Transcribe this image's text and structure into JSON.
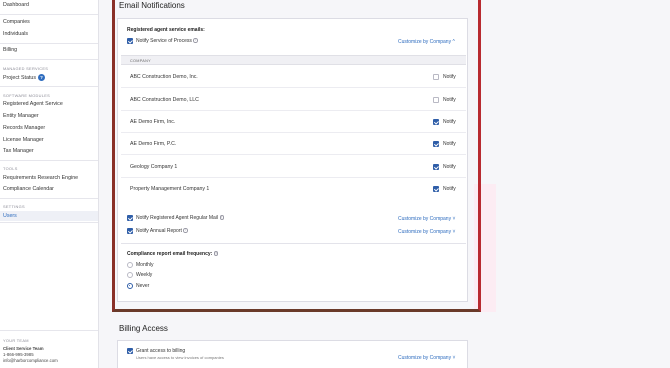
{
  "sidebar": {
    "top_items": [
      "Dashboard",
      "Companies",
      "Individuals",
      "Billing"
    ],
    "managed_services": {
      "heading": "MANAGED SERVICES",
      "items": [
        "Project Status"
      ],
      "badge": "?"
    },
    "software_modules": {
      "heading": "SOFTWARE MODULES",
      "items": [
        "Registered Agent Service",
        "Entity Manager",
        "Records Manager",
        "License Manager",
        "Tax Manager"
      ]
    },
    "tools": {
      "heading": "TOOLS",
      "items": [
        "Requirements Research Engine",
        "Compliance Calendar"
      ]
    },
    "settings": {
      "heading": "SETTINGS",
      "items": [
        "Users"
      ],
      "active": "Users"
    },
    "team": {
      "heading": "YOUR TEAM",
      "name": "Client Service Team",
      "phone": "1-866-995-3985",
      "email": "info@harborcompliance.com"
    }
  },
  "email_notifications": {
    "title": "Email Notifications",
    "registered_agent_heading": "Registered agent service emails:",
    "service_of_process": {
      "label": "Notify Service of Process",
      "checked": true,
      "customize_label": "Customize by Company",
      "customize_icon": "chevron-up-icon"
    },
    "company_column_header": "COMPANY",
    "notify_label": "Notify",
    "companies": [
      {
        "name": "ABC Construction Demo, Inc.",
        "checked": false
      },
      {
        "name": "ABC Construction Demo, LLC",
        "checked": false
      },
      {
        "name": "AE Demo Firm, Inc.",
        "checked": true
      },
      {
        "name": "AE Demo Firm, P.C.",
        "checked": true
      },
      {
        "name": "Geology Company 1",
        "checked": true
      },
      {
        "name": "Property Management Company 1",
        "checked": true
      }
    ],
    "regular_mail": {
      "label": "Notify Registered Agent Regular Mail",
      "checked": true,
      "customize_label": "Customize by Company",
      "customize_icon": "chevron-down-icon"
    },
    "annual_report": {
      "label": "Notify Annual Report",
      "checked": true,
      "customize_label": "Customize by Company",
      "customize_icon": "chevron-down-icon"
    },
    "compliance_frequency": {
      "heading": "Compliance report email frequency:",
      "options": [
        "Monthly",
        "Weekly",
        "Never"
      ],
      "selected": "Never"
    }
  },
  "billing_access": {
    "title": "Billing Access",
    "grant_label": "Grant access to billing",
    "grant_description": "Users have access to view invoices of companies",
    "checked": true,
    "customize_label": "Customize by Company",
    "customize_icon": "chevron-down-icon"
  },
  "colors": {
    "accent": "#2f6dbf",
    "checkbox": "#2f5ea8",
    "highlight_frame": "#d9232f"
  }
}
